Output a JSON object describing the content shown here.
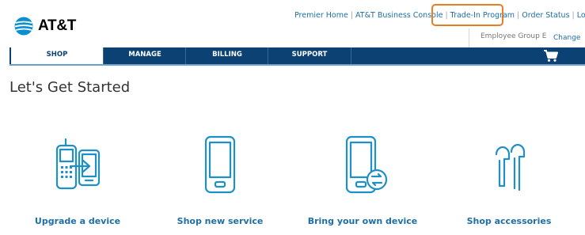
{
  "brand": {
    "name": "AT&T"
  },
  "top_links": [
    {
      "label": "Premier Home"
    },
    {
      "label": "AT&T Business Console"
    },
    {
      "label": "Trade-In Program"
    },
    {
      "label": "Order Status"
    },
    {
      "label": "Log out"
    }
  ],
  "group": {
    "name": "Employee Group E",
    "change_label": "Change"
  },
  "nav": {
    "tabs": [
      {
        "label": "SHOP",
        "active": true
      },
      {
        "label": "MANAGE"
      },
      {
        "label": "BILLING"
      },
      {
        "label": "SUPPORT"
      }
    ],
    "cart_icon": "cart-icon"
  },
  "main": {
    "heading": "Let's Get Started",
    "options": [
      {
        "label": "Upgrade a device",
        "icon": "upgrade-device-icon"
      },
      {
        "label": "Shop new service",
        "icon": "smartphone-icon"
      },
      {
        "label": "Bring your own device",
        "icon": "byod-icon"
      },
      {
        "label": "Shop accessories",
        "icon": "earbuds-icon"
      }
    ]
  },
  "colors": {
    "nav": "#0b4173",
    "link": "#1d6fa5",
    "icon": "#1f8fc7",
    "highlight": "#e67e22"
  }
}
